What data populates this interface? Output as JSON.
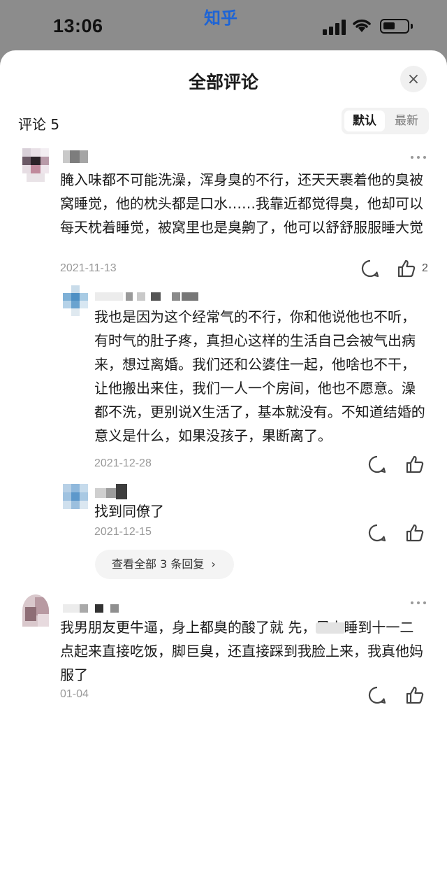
{
  "status_bar": {
    "time": "13:06",
    "app_name": "知乎"
  },
  "sheet": {
    "title": "全部评论",
    "close_icon": "×",
    "comment_count_label": "评论 5",
    "sort": {
      "default": "默认",
      "newest": "最新"
    }
  },
  "comments": [
    {
      "text": "腌入味都不可能洗澡，浑身臭的不行，还天天裹着他的臭被窝睡觉，他的枕头都是口水……我靠近都觉得臭，他却可以每天枕着睡觉，被窝里也是臭齁了，他可以舒舒服服睡大觉",
      "date": "2021-11-13",
      "likes": "2",
      "replies": [
        {
          "text": "我也是因为这个经常气的不行，你和他说他也不听，有时气的肚子疼，真担心这样的生活自己会被气出病来，想过离婚。我们还和公婆住一起，他啥也不干，让他搬出来住，我们一人一个房间，他也不愿意。澡都不洗，更别说X生活了，基本就没有。不知道结婚的意义是什么，如果没孩子，果断离了。",
          "date": "2021-12-28"
        },
        {
          "text": "找到同僚了",
          "date": "2021-12-15"
        }
      ],
      "view_all_label": "查看全部 3 条回复",
      "view_all_chevron": "›"
    },
    {
      "text": "我男朋友更牛逼，身上都臭的酸了就 先，早上睡到十一二点起来直接吃饭，脚巨臭，还直接踩到我脸上来，我真他妈服了",
      "date": "01-04"
    }
  ],
  "icons": [
    "signal-icon",
    "wifi-icon",
    "battery-icon",
    "close-icon",
    "more-icon",
    "comment-icon",
    "like-icon",
    "chevron-right-icon"
  ]
}
